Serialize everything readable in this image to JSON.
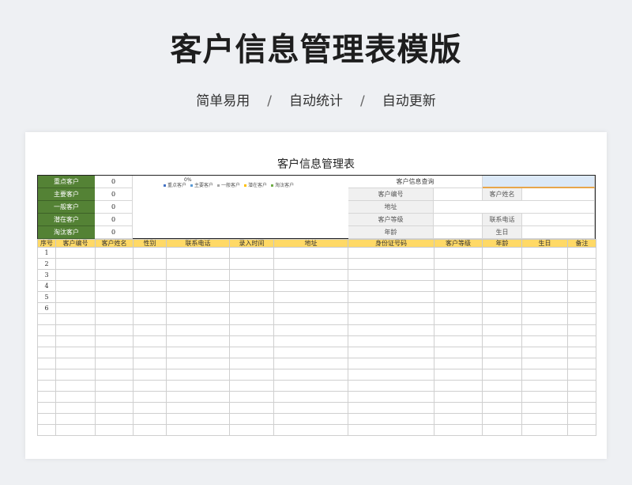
{
  "header": {
    "title": "客户信息管理表模版",
    "subtitle": [
      "简单易用",
      "自动统计",
      "自动更新"
    ],
    "separator": "/"
  },
  "sheet": {
    "title": "客户信息管理表",
    "stats": [
      {
        "label": "重点客户",
        "value": "0"
      },
      {
        "label": "主要客户",
        "value": "0"
      },
      {
        "label": "一般客户",
        "value": "0"
      },
      {
        "label": "潜在客户",
        "value": "0"
      },
      {
        "label": "淘汰客户",
        "value": "0"
      }
    ],
    "chart": {
      "percent_label": "0%",
      "legend": [
        {
          "name": "重点客户",
          "color": "#4472c4"
        },
        {
          "name": "主要客户",
          "color": "#5b9bd5"
        },
        {
          "name": "一般客户",
          "color": "#a5a5a5"
        },
        {
          "name": "潜在客户",
          "color": "#ffc000"
        },
        {
          "name": "淘汰客户",
          "color": "#70ad47"
        }
      ]
    },
    "query": {
      "title": "客户信息查询",
      "customer_id_label": "客户编号",
      "customer_name_label": "客户姓名",
      "address_label": "地址",
      "level_label": "客户等级",
      "phone_label": "联系电话",
      "age_label": "年龄",
      "birthday_label": "生日"
    },
    "table": {
      "headers": [
        "序号",
        "客户编号",
        "客户姓名",
        "性别",
        "联系电话",
        "录入时间",
        "地址",
        "身份证号码",
        "客户等级",
        "年龄",
        "生日",
        "备注"
      ],
      "row_numbers": [
        "1",
        "2",
        "3",
        "4",
        "5",
        "6",
        "",
        "",
        "",
        "",
        "",
        "",
        "",
        "",
        "",
        "",
        ""
      ]
    }
  },
  "colors": {
    "stat_green": "#548235",
    "header_yellow": "#ffd966",
    "query_blue": "#dce9f7",
    "query_orange": "#e8a64a"
  }
}
